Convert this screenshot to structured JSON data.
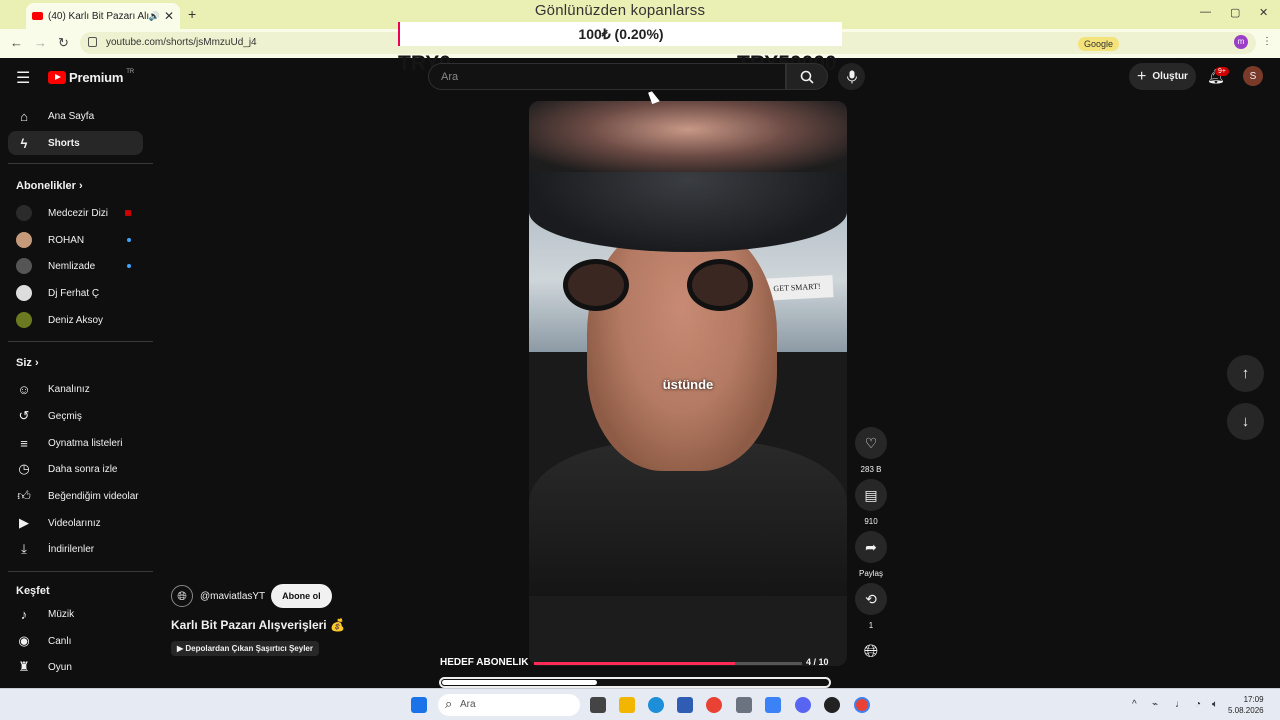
{
  "browser": {
    "tab_title": "(40) Karlı Bit Pazarı Alışveriş",
    "url": "youtube.com/shorts/jsMmzuUd_j4",
    "new_tab": "+",
    "close": "✕",
    "win_min": "—",
    "win_max": "▢",
    "win_close": "✕",
    "google_chip": "Google"
  },
  "overlay": {
    "title": "Gönlünüzden kopanlarss",
    "amount": "100₺ (0.20%)",
    "left_label": "TRY0",
    "right_label": "TRY50000"
  },
  "header": {
    "logo_text": "Premium",
    "logo_region": "TR",
    "search_placeholder": "Ara",
    "create_label": "Oluştur",
    "notif_count": "9+",
    "avatar_letter": "S"
  },
  "sidebar": {
    "main": [
      {
        "label": "Ana Sayfa",
        "icon": "home-icon"
      },
      {
        "label": "Shorts",
        "icon": "shorts-icon"
      }
    ],
    "subs_heading": "Abonelikler",
    "subs": [
      {
        "label": "Medcezir Dizi",
        "color": "#2b2b2b"
      },
      {
        "label": "ROHAN",
        "color": "#c49a7a"
      },
      {
        "label": "Nemlizade",
        "color": "#555555"
      },
      {
        "label": "Dj Ferhat Ç",
        "color": "#dddddd"
      },
      {
        "label": "Deniz Aksoy",
        "color": "#6b7a20"
      }
    ],
    "you_heading": "Siz",
    "you": [
      {
        "label": "Kanalınız",
        "icon": "channel-icon"
      },
      {
        "label": "Geçmiş",
        "icon": "history-icon"
      },
      {
        "label": "Oynatma listeleri",
        "icon": "playlist-icon"
      },
      {
        "label": "Daha sonra izle",
        "icon": "clock-icon"
      },
      {
        "label": "Beğendiğim videolar",
        "icon": "thumbs-up-icon"
      },
      {
        "label": "Videolarınız",
        "icon": "video-icon"
      },
      {
        "label": "İndirilenler",
        "icon": "download-icon"
      }
    ],
    "explore_heading": "Keşfet",
    "explore": [
      {
        "label": "Müzik",
        "icon": "music-icon"
      },
      {
        "label": "Canlı",
        "icon": "live-icon"
      },
      {
        "label": "Oyun",
        "icon": "gaming-icon"
      }
    ]
  },
  "short": {
    "caption": "üstünde",
    "sign_text": "GET SMART!",
    "channel": "@maviatlasYT",
    "subscribe_label": "Abone ol",
    "title": "Karlı Bit Pazarı Alışverişleri 💰",
    "chip": "▶ Depolardan Çıkan Şaşırtıcı Şeyler",
    "likes": "283 B",
    "comments": "910",
    "share": "Paylaş",
    "remix": "1",
    "goal_label": "HEDEF ABONELIK",
    "goal_count": "4 / 10",
    "goal_fraction": 0.75,
    "progress_fraction": 0.4
  },
  "taskbar": {
    "search_placeholder": "Ara",
    "time": "17:09",
    "date": "5.08.2026"
  }
}
